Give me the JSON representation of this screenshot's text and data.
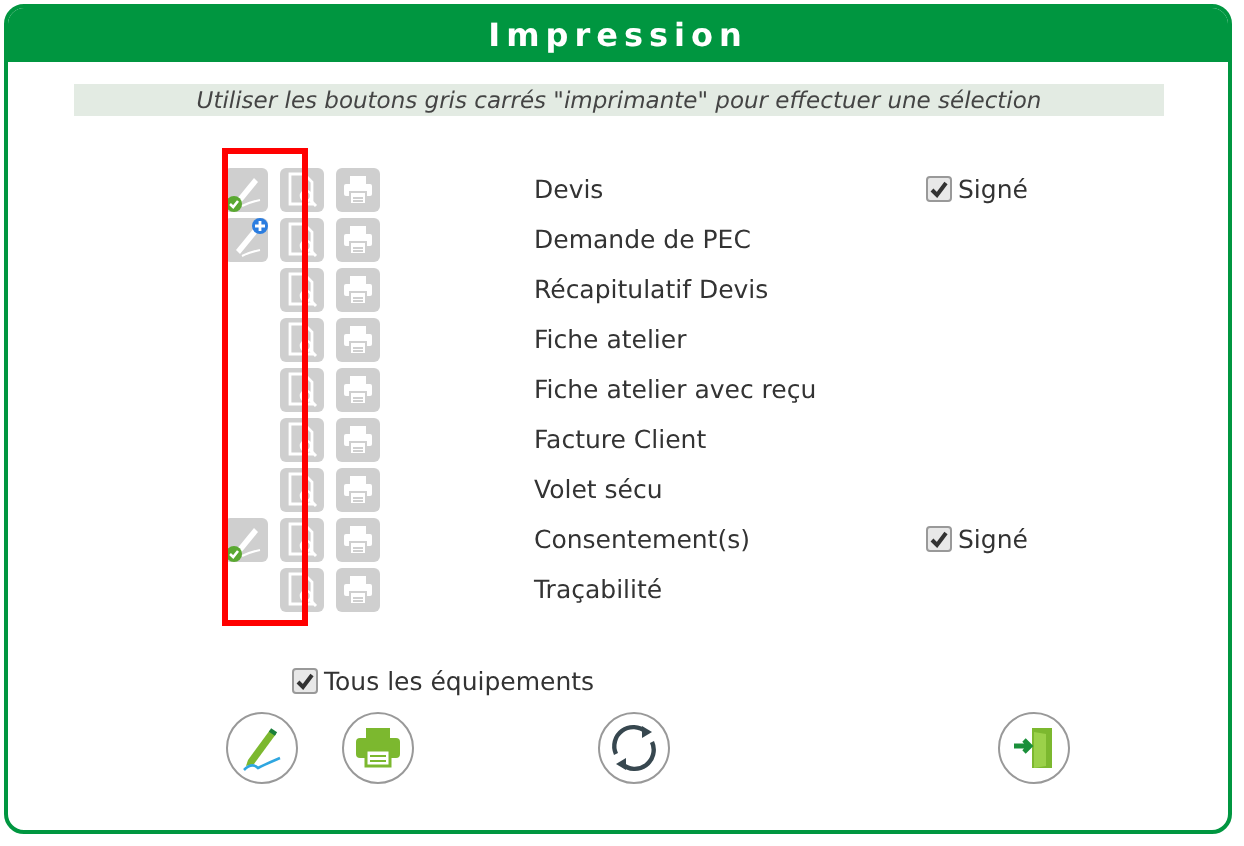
{
  "window": {
    "title": "Impression"
  },
  "hint": "Utiliser les boutons gris carrés \"imprimante\" pour effectuer une sélection",
  "documents": [
    {
      "label": "Devis",
      "kind": "signed",
      "signed_checkbox": {
        "label": "Signé",
        "checked": true
      }
    },
    {
      "label": "Demande de PEC",
      "kind": "unsigned"
    },
    {
      "label": "Récapitulatif Devis"
    },
    {
      "label": "Fiche atelier"
    },
    {
      "label": "Fiche atelier avec reçu"
    },
    {
      "label": "Facture Client"
    },
    {
      "label": "Volet sécu"
    },
    {
      "label": "Consentement(s)",
      "kind": "signed",
      "signed_checkbox": {
        "label": "Signé",
        "checked": true
      }
    },
    {
      "label": "Traçabilité"
    }
  ],
  "all_equipment": {
    "label": "Tous les équipements",
    "checked": true
  },
  "actions": [
    {
      "kind": "sign"
    },
    {
      "kind": "print"
    },
    {
      "kind": "refresh"
    },
    {
      "kind": "exit"
    }
  ]
}
